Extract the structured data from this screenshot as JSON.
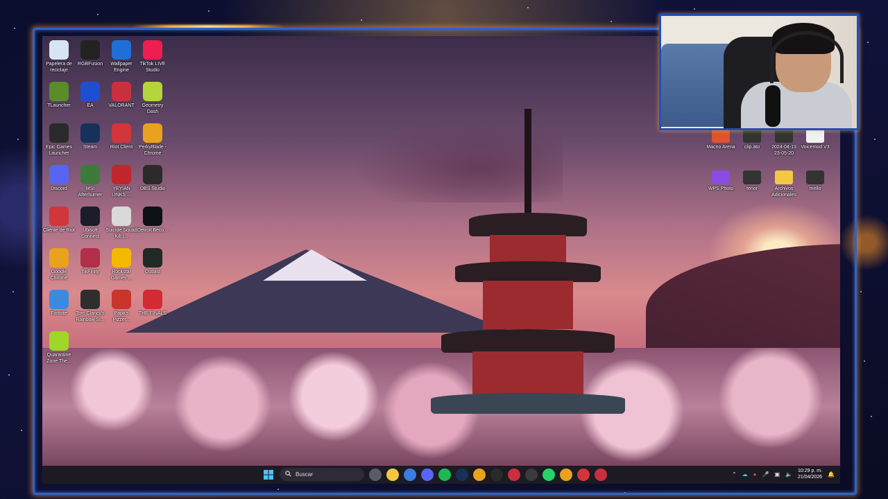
{
  "desktop": {
    "left_icons": [
      {
        "label": "Papelera de reciclaje",
        "icon": "recycle-bin-icon",
        "color": "#d7e4f2"
      },
      {
        "label": "RGBFusion",
        "icon": "rgb-fusion-icon",
        "color": "#222222"
      },
      {
        "label": "Wallpaper Engine",
        "icon": "wallpaper-engine-icon",
        "color": "#1f6fd6"
      },
      {
        "label": "TikTok LIVE Studio",
        "icon": "tiktok-icon",
        "color": "#ee1d52"
      },
      {
        "label": "TLauncher",
        "icon": "minecraft-block-icon",
        "color": "#5b8c2a"
      },
      {
        "label": "EA",
        "icon": "ea-icon",
        "color": "#1e4fd2"
      },
      {
        "label": "VALORANT",
        "icon": "valorant-icon",
        "color": "#c8303e"
      },
      {
        "label": "Geometry Dash",
        "icon": "geometry-dash-icon",
        "color": "#b5d63a"
      },
      {
        "label": "Epic Games Launcher",
        "icon": "epic-games-icon",
        "color": "#2a2a2a"
      },
      {
        "label": "Steam",
        "icon": "steam-icon",
        "color": "#17325a"
      },
      {
        "label": "Riot Client",
        "icon": "riot-icon",
        "color": "#d1363a"
      },
      {
        "label": "PerkyBlade - Chrome",
        "icon": "chrome-icon",
        "color": "#e8a21e"
      },
      {
        "label": "Discord",
        "icon": "discord-icon",
        "color": "#5865f2"
      },
      {
        "label": "MSI Afterburner",
        "icon": "msi-afterburner-icon",
        "color": "#3d7a3b"
      },
      {
        "label": "YEYIAN LINKS ...",
        "icon": "yeyian-icon",
        "color": "#c0262c"
      },
      {
        "label": "OBS Studio",
        "icon": "obs-icon",
        "color": "#2b2b2b"
      },
      {
        "label": "Cliente de Riot",
        "icon": "riot-icon",
        "color": "#d1363a"
      },
      {
        "label": "Ubisoft Connect",
        "icon": "ubisoft-icon",
        "color": "#1c1c2a"
      },
      {
        "label": "Suicide Squad Kill t...",
        "icon": "suicide-squad-icon",
        "color": "#d9d9d9"
      },
      {
        "label": "Detroit Beco...",
        "icon": "detroit-icon",
        "color": "#0d1116"
      },
      {
        "label": "Google Chrome",
        "icon": "chrome-icon",
        "color": "#e8a21e"
      },
      {
        "label": "TikFinity",
        "icon": "tikfinity-icon",
        "color": "#b0304a"
      },
      {
        "label": "Rockstar Games ...",
        "icon": "rockstar-icon",
        "color": "#f5b800"
      },
      {
        "label": "Outlast",
        "icon": "outlast-icon",
        "color": "#1f2a25"
      },
      {
        "label": "Fortnite",
        "icon": "fortnite-icon",
        "color": "#3a8be0"
      },
      {
        "label": "Tom Clancy's Rainbow Si...",
        "icon": "rainbow-six-icon",
        "color": "#2e2e2e"
      },
      {
        "label": "Papa's Pizzer...",
        "icon": "papas-pizzeria-icon",
        "color": "#c9342c"
      },
      {
        "label": "THE FINALS",
        "icon": "the-finals-icon",
        "color": "#d42a34"
      },
      {
        "label": "Quarantine Zone The...",
        "icon": "quarantine-zone-icon",
        "color": "#9ed62a"
      }
    ],
    "right_icons": [
      {
        "label": "Macno Arena",
        "icon": "image-icon",
        "color": "#e0522f"
      },
      {
        "label": "clip.ato",
        "icon": "video-file-icon",
        "color": "#333333"
      },
      {
        "label": "2024-04-13 23-05-20",
        "icon": "video-file-icon",
        "color": "#333333"
      },
      {
        "label": "Voicemod V3",
        "icon": "blank-file-icon",
        "color": "#f2f2f2"
      },
      {
        "label": "WPS Photo",
        "icon": "wps-photo-icon",
        "color": "#8a4be0"
      },
      {
        "label": "tenor",
        "icon": "video-file-icon",
        "color": "#333333"
      },
      {
        "label": "Archivos Adicionales",
        "icon": "folder-icon",
        "color": "#f2c744"
      },
      {
        "label": "mello",
        "icon": "video-file-icon",
        "color": "#333333"
      }
    ]
  },
  "taskbar": {
    "search_placeholder": "Buscar",
    "apps": [
      {
        "icon": "task-view-icon",
        "color": "#5b5b66"
      },
      {
        "icon": "file-explorer-icon",
        "color": "#f2c744"
      },
      {
        "icon": "store-icon",
        "color": "#3b7de0"
      },
      {
        "icon": "discord-icon",
        "color": "#5865f2"
      },
      {
        "icon": "spotify-icon",
        "color": "#1db954"
      },
      {
        "icon": "steam-icon",
        "color": "#17325a"
      },
      {
        "icon": "chrome-icon",
        "color": "#e8a21e"
      },
      {
        "icon": "epic-games-icon",
        "color": "#2a2a2a"
      },
      {
        "icon": "valorant-icon",
        "color": "#c8303e"
      },
      {
        "icon": "obs-icon",
        "color": "#3a3a3a"
      },
      {
        "icon": "whatsapp-icon",
        "color": "#25d366"
      },
      {
        "icon": "chrome-icon",
        "color": "#e8a21e"
      },
      {
        "icon": "riot-icon",
        "color": "#d1363a"
      },
      {
        "icon": "valorant-icon",
        "color": "#c8303e"
      }
    ],
    "tray": {
      "time": "10:29 p. m.",
      "date": "21/04/2026"
    }
  }
}
